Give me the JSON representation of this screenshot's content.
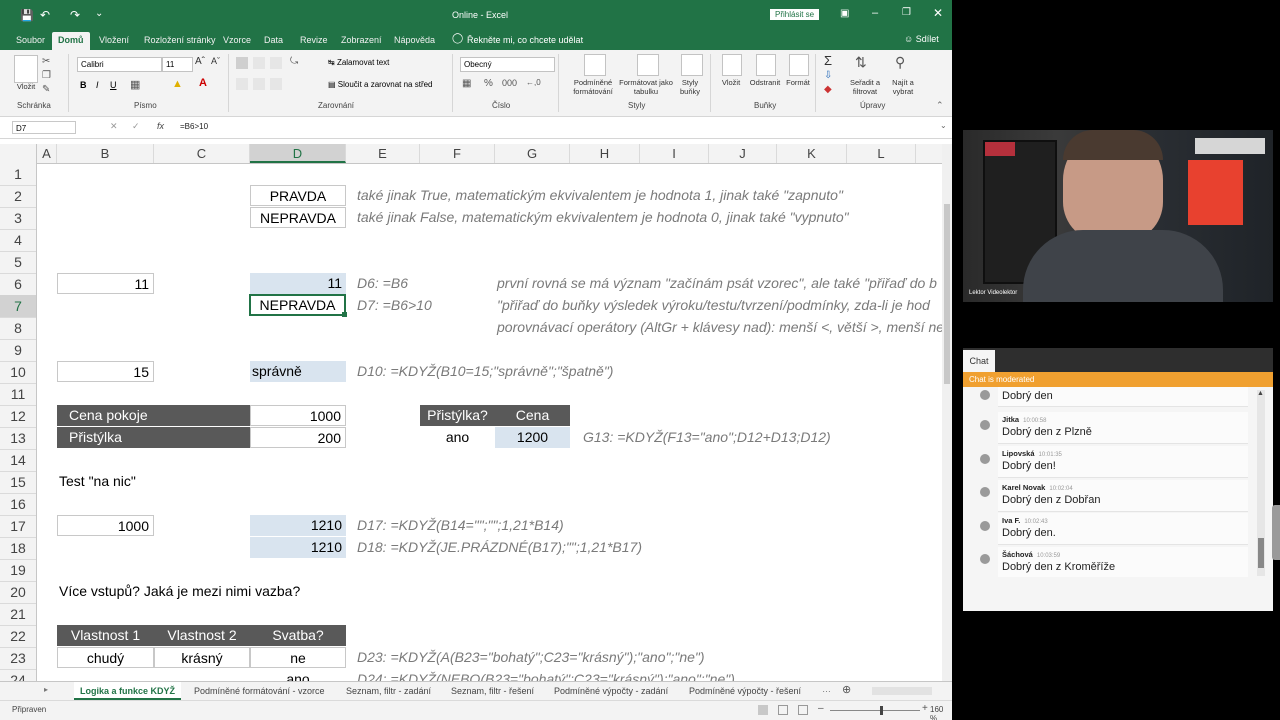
{
  "app": {
    "title": "Online - Excel",
    "signin_button": "Přihlásit se",
    "tabs": [
      "Soubor",
      "Domů",
      "Vložení",
      "Rozložení stránky",
      "Vzorce",
      "Data",
      "Revize",
      "Zobrazení",
      "Nápověda"
    ],
    "tell_me": "Řekněte mi, co chcete udělat",
    "share": "Sdílet"
  },
  "ribbon": {
    "clipboard": {
      "paste": "Vložit",
      "label": "Schránka"
    },
    "font": {
      "name": "Calibri",
      "size": "11",
      "label": "Písmo",
      "bold": "B",
      "italic": "I",
      "underline": "U"
    },
    "alignment": {
      "wrap": "Zalamovat text",
      "merge": "Sloučit a zarovnat na střed",
      "label": "Zarovnání"
    },
    "number": {
      "format": "Obecný",
      "label": "Číslo"
    },
    "styles": {
      "conditional": "Podmíněné formátování",
      "table": "Formátovat jako tabulku",
      "cell_styles": "Styly buňky",
      "label": "Styly"
    },
    "cells": {
      "insert": "Vložit",
      "delete": "Odstranit",
      "format": "Formát",
      "label": "Buňky"
    },
    "editing": {
      "sort": "Seřadit a filtrovat",
      "find": "Najít a vybrat",
      "label": "Úpravy"
    }
  },
  "formula_bar": {
    "name_box": "D7",
    "formula": "=B6>10",
    "fx": "fx"
  },
  "columns": [
    "A",
    "B",
    "C",
    "D",
    "E",
    "F",
    "G",
    "H",
    "I",
    "J",
    "K",
    "L"
  ],
  "rows": [
    "1",
    "2",
    "3",
    "4",
    "5",
    "6",
    "7",
    "8",
    "9",
    "10",
    "11",
    "12",
    "13",
    "14",
    "15",
    "16",
    "17",
    "18",
    "19",
    "20",
    "21",
    "22",
    "23",
    "24"
  ],
  "cells": {
    "D2": "PRAVDA",
    "E2": "také jinak True, matematickým ekvivalentem je hodnota 1, jinak také \"zapnuto\"",
    "D3": "NEPRAVDA",
    "E3": "také jinak False, matematickým ekvivalentem je hodnota 0, jinak také \"vypnuto\"",
    "B6": "11",
    "D6": "11",
    "E6": "D6: =B6",
    "G6": "první rovná se má význam \"začínám psát vzorec\", ale také \"přiřaď do b",
    "D7": "NEPRAVDA",
    "E7": "D7: =B6>10",
    "G7": "\"přiřaď do buňky výsledek výroku/testu/tvrzení/podmínky, zda-li je hod",
    "G8": "porovnávací operátory (AltGr + klávesy nad): menší <, větší >, menší ne",
    "B10": "15",
    "D10": "správně",
    "E10": "D10: =KDYŽ(B10=15;\"správně\";\"špatně\")",
    "B12": "Cena pokoje",
    "D12": "1000",
    "F12": "Přistýlka?",
    "G12": "Cena",
    "B13": "Přistýlka",
    "D13": "200",
    "F13": "ano",
    "G13": "1200",
    "H13": "G13: =KDYŽ(F13=\"ano\";D12+D13;D12)",
    "A15": "Test \"na nic\"",
    "B17": "1000",
    "D17": "1210",
    "E17": "D17: =KDYŽ(B14=\"\";\"\";1,21*B14)",
    "D18": "1210",
    "E18": "D18: =KDYŽ(JE.PRÁZDNÉ(B17);\"\";1,21*B17)",
    "A20": "Více vstupů? Jaká je mezi nimi vazba?",
    "B22": "Vlastnost 1",
    "C22": "Vlastnost 2",
    "D22": "Svatba?",
    "B23": "chudý",
    "C23": "krásný",
    "D23": "ne",
    "E23": "D23: =KDYŽ(A(B23=\"bohatý\";C23=\"krásný\");\"ano\";\"ne\")",
    "D24": "ano",
    "E24": "D24: =KDYŽ(NEBO(B23=\"bohatý\";C23=\"krásný\");\"ano\";\"ne\")"
  },
  "sheet_tabs": [
    "Logika a funkce KDYŽ",
    "Podmíněné formátování - vzorce",
    "Seznam, filtr - zadání",
    "Seznam, filtr - řešení",
    "Podmíněné výpočty - zadání",
    "Podmíněné výpočty - řešení"
  ],
  "status": {
    "ready": "Připraven",
    "zoom": "160 %"
  },
  "video": {
    "participant": "Lektor Videolektor"
  },
  "chat": {
    "tab": "Chat",
    "moderated": "Chat is moderated",
    "messages": [
      {
        "name": "",
        "time": "",
        "text": "Dobrý den"
      },
      {
        "name": "Jitka",
        "time": "10:00:58",
        "text": "Dobrý den z Plzně"
      },
      {
        "name": "Lipovská",
        "time": "10:01:35",
        "text": "Dobrý den!"
      },
      {
        "name": "Karel Novak",
        "time": "10:02:04",
        "text": "Dobrý den z Dobřan"
      },
      {
        "name": "Iva F.",
        "time": "10:02:43",
        "text": "Dobrý den."
      },
      {
        "name": "Šáchová",
        "time": "10:03:59",
        "text": "Dobrý den z Kroměříže"
      }
    ]
  },
  "colors": {
    "excel_green": "#217346",
    "dark_header": "#595959",
    "blue_fill": "#d9e4ef",
    "chat_banner": "#f0a030"
  }
}
